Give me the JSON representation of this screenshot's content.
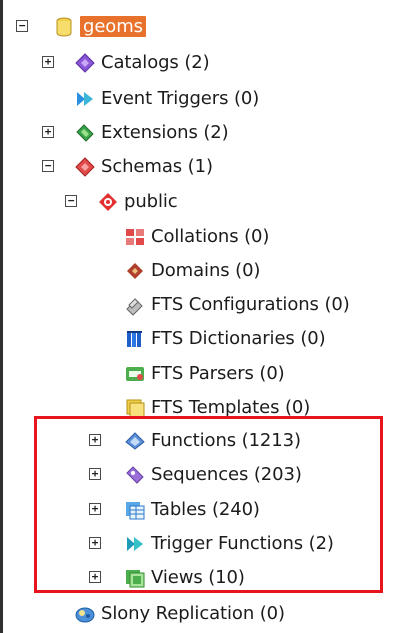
{
  "tree": {
    "root": {
      "label": "geoms",
      "toggle": "⊟"
    },
    "items": [
      {
        "key": "catalogs",
        "label": "Catalogs (2)",
        "toggle": "⊞"
      },
      {
        "key": "event_triggers",
        "label": "Event Triggers (0)",
        "toggle": ""
      },
      {
        "key": "extensions",
        "label": "Extensions (2)",
        "toggle": "⊞"
      },
      {
        "key": "schemas",
        "label": "Schemas (1)",
        "toggle": "⊟"
      },
      {
        "key": "public",
        "label": "public",
        "toggle": "⊟"
      },
      {
        "key": "collations",
        "label": "Collations (0)",
        "toggle": ""
      },
      {
        "key": "domains",
        "label": "Domains (0)",
        "toggle": ""
      },
      {
        "key": "fts_configurations",
        "label": "FTS Configurations (0)",
        "toggle": ""
      },
      {
        "key": "fts_dictionaries",
        "label": "FTS Dictionaries (0)",
        "toggle": ""
      },
      {
        "key": "fts_parsers",
        "label": "FTS Parsers (0)",
        "toggle": ""
      },
      {
        "key": "fts_templates",
        "label": "FTS Templates (0)",
        "toggle": ""
      },
      {
        "key": "functions",
        "label": "Functions (1213)",
        "toggle": "⊞"
      },
      {
        "key": "sequences",
        "label": "Sequences (203)",
        "toggle": "⊞"
      },
      {
        "key": "tables",
        "label": "Tables (240)",
        "toggle": "⊞"
      },
      {
        "key": "trigger_functions",
        "label": "Trigger Functions (2)",
        "toggle": "⊞"
      },
      {
        "key": "views",
        "label": "Views (10)",
        "toggle": "⊞"
      },
      {
        "key": "slony_replication",
        "label": "Slony Replication (0)",
        "toggle": ""
      }
    ]
  },
  "colors": {
    "selection": "#e8722c",
    "highlight_box": "#e8141d"
  },
  "icons": {
    "root": "database-icon",
    "catalogs": "catalogs-icon",
    "event_triggers": "event-trigger-icon",
    "extensions": "extension-icon",
    "schemas": "schemas-icon",
    "public": "schema-icon",
    "collations": "collation-icon",
    "domains": "domain-icon",
    "fts_configurations": "fts-configuration-icon",
    "fts_dictionaries": "fts-dictionary-icon",
    "fts_parsers": "fts-parser-icon",
    "fts_templates": "fts-template-icon",
    "functions": "function-icon",
    "sequences": "sequence-icon",
    "tables": "table-icon",
    "trigger_functions": "trigger-function-icon",
    "views": "view-icon",
    "slony_replication": "slony-icon"
  }
}
